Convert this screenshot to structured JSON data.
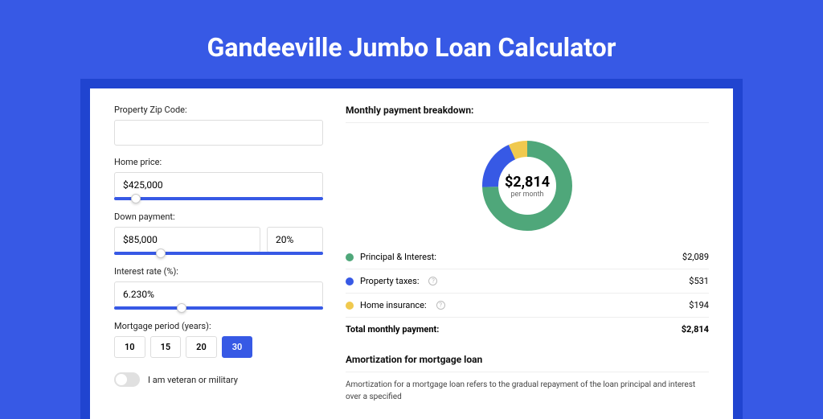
{
  "title": "Gandeeville Jumbo Loan Calculator",
  "form": {
    "zip_label": "Property Zip Code:",
    "zip_value": "",
    "price_label": "Home price:",
    "price_value": "$425,000",
    "dp_label": "Down payment:",
    "dp_value": "$85,000",
    "dp_pct": "20%",
    "rate_label": "Interest rate (%):",
    "rate_value": "6.230%",
    "period_label": "Mortgage period (years):",
    "period_options": [
      "10",
      "15",
      "20",
      "30"
    ],
    "period_selected": "30",
    "veteran_label": "I am veteran or military"
  },
  "breakdown": {
    "heading": "Monthly payment breakdown:",
    "total_display": "$2,814",
    "total_sub": "per month",
    "rows": [
      {
        "color": "#4FA77A",
        "label": "Principal & Interest:",
        "value": "$2,089",
        "info": false
      },
      {
        "color": "#3759E5",
        "label": "Property taxes:",
        "value": "$531",
        "info": true
      },
      {
        "color": "#F0C94E",
        "label": "Home insurance:",
        "value": "$194",
        "info": true
      }
    ],
    "total_row": {
      "label": "Total monthly payment:",
      "value": "$2,814"
    }
  },
  "chart_data": {
    "type": "pie",
    "title": "Monthly payment breakdown",
    "categories": [
      "Principal & Interest",
      "Property taxes",
      "Home insurance"
    ],
    "values": [
      2089,
      531,
      194
    ],
    "colors": [
      "#4FA77A",
      "#3759E5",
      "#F0C94E"
    ],
    "center_label": "$2,814",
    "center_sub": "per month"
  },
  "amort": {
    "heading": "Amortization for mortgage loan",
    "body": "Amortization for a mortgage loan refers to the gradual repayment of the loan principal and interest over a specified"
  }
}
